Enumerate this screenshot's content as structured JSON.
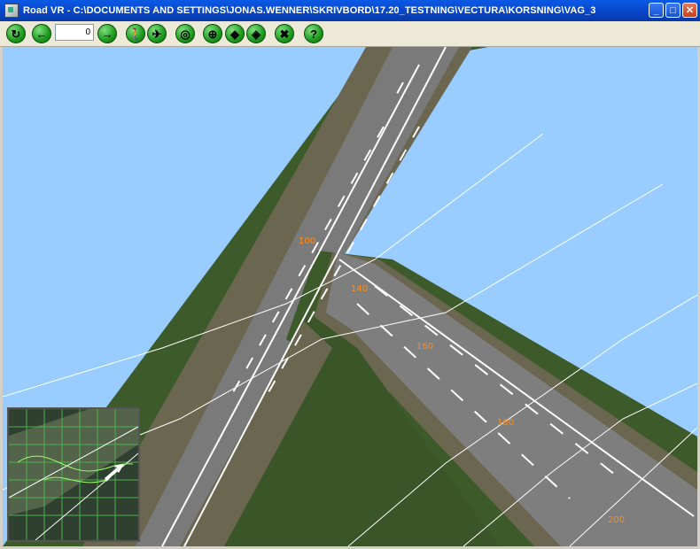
{
  "window": {
    "title": "Road VR - C:\\DOCUMENTS AND SETTINGS\\JONAS.WENNER\\SKRIVBORD\\17.20_TESTNING\\VECTURA\\KORSNING\\VAG_3",
    "minimize_label": "_",
    "maximize_label": "□",
    "close_label": "✕"
  },
  "toolbar": {
    "reset_icon": "↻",
    "back_icon": "←",
    "station_value": "0",
    "forward_icon": "→",
    "walk_icon": "🚶",
    "fly_icon": "✈",
    "drive_icon": "◎",
    "globe_icon": "⊕",
    "layers_icon": "◆",
    "view_icon": "◈",
    "tools_icon": "✖",
    "help_icon": "?"
  },
  "scene": {
    "station_labels": [
      "100",
      "140",
      "160",
      "180",
      "200"
    ]
  },
  "colors": {
    "sky": "#99ccff",
    "grass": "#3d5a2a",
    "road": "#808080",
    "shoulder": "#6f6a52",
    "station_label": "#ff8c1a"
  }
}
